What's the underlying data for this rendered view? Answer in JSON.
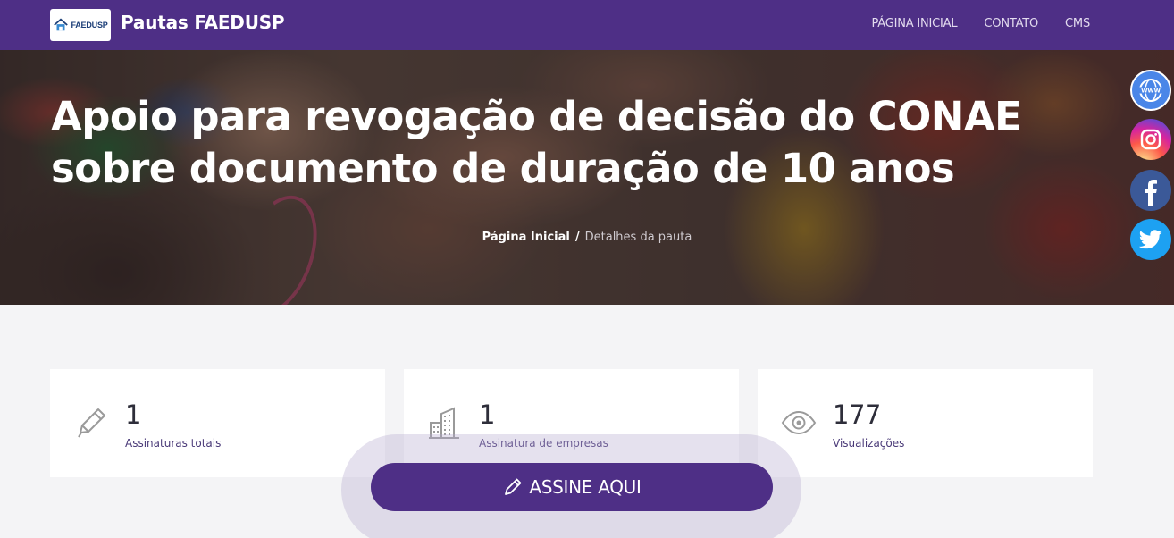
{
  "navbar": {
    "logo_text": "FAEDUSP",
    "brand": "Pautas FAEDUSP",
    "links": [
      "PÁGINA INICIAL",
      "CONTATO",
      "CMS"
    ]
  },
  "hero": {
    "title_line1": "Apoio para revogação de decisão do CONAE",
    "title_line2": "sobre documento de duração de 10 anos",
    "breadcrumb": {
      "home": "Página Inicial",
      "separator": "/",
      "current": "Detalhes da pauta"
    }
  },
  "social": {
    "items": [
      "website-icon",
      "instagram-icon",
      "facebook-icon",
      "twitter-icon"
    ]
  },
  "stats": [
    {
      "icon": "pencil-icon",
      "value": "1",
      "label": "Assinaturas totais"
    },
    {
      "icon": "buildings-icon",
      "value": "1",
      "label": "Assinatura de empresas"
    },
    {
      "icon": "eye-icon",
      "value": "177",
      "label": "Visualizações"
    }
  ],
  "sign_button": {
    "label": "ASSINE AQUI"
  },
  "colors": {
    "primary": "#4e2f86",
    "label": "#4a3a78"
  }
}
